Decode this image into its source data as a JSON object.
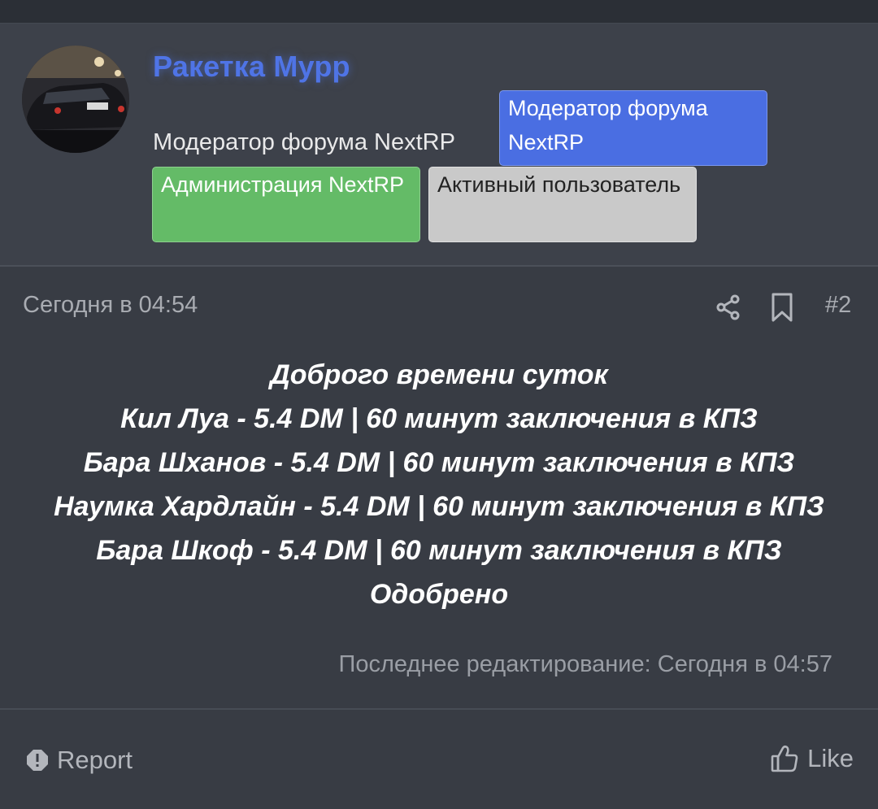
{
  "user": {
    "name": "Ракетка Мурр",
    "title": "Модератор форума NextRP",
    "badges": {
      "moderator": "Модератор форума NextRP",
      "administration": "Администрация NextRP",
      "active_user": "Активный пользователь"
    }
  },
  "post": {
    "date": "Сегодня в 04:54",
    "number": "#2",
    "lines": [
      "Доброго времени суток",
      "Кил Луа - 5.4 DM | 60 минут заключения в КПЗ",
      "Бара Шханов - 5.4 DM | 60 минут заключения в КПЗ",
      "Наумка Хардлайн - 5.4 DM | 60 минут заключения в КПЗ",
      "Бара Шкоф - 5.4 DM | 60 минут заключения в КПЗ",
      "Одобрено"
    ],
    "edited": "Последнее редактирование: Сегодня в 04:57"
  },
  "actions": {
    "report_label": "Report",
    "like_label": "Like"
  },
  "icons": {
    "share": "share-icon",
    "bookmark": "bookmark-icon",
    "report": "report-icon",
    "like": "thumbs-up-icon"
  },
  "colors": {
    "username": "#4f74e6",
    "badge_moderator": "#4a6ee2",
    "badge_administration": "#64bb67",
    "badge_active": "#c9c9c9"
  }
}
